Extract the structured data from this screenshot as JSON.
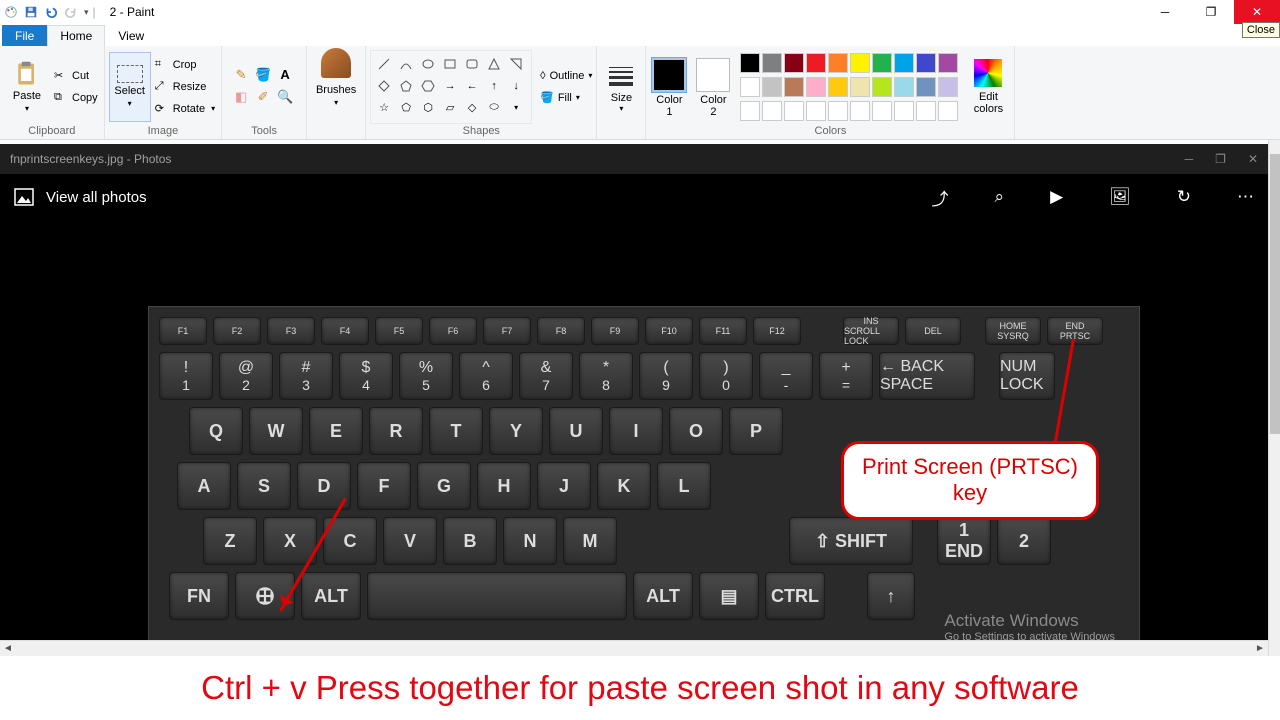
{
  "window": {
    "title": "2 - Paint",
    "close_tooltip": "Close"
  },
  "tabs": {
    "file": "File",
    "home": "Home",
    "view": "View"
  },
  "clipboard": {
    "paste": "Paste",
    "cut": "Cut",
    "copy": "Copy",
    "label": "Clipboard"
  },
  "image": {
    "select": "Select",
    "crop": "Crop",
    "resize": "Resize",
    "rotate": "Rotate",
    "label": "Image"
  },
  "tools": {
    "label": "Tools"
  },
  "brushes": {
    "label": "Brushes"
  },
  "shapes": {
    "outline": "Outline",
    "fill": "Fill",
    "label": "Shapes"
  },
  "size": {
    "label": "Size"
  },
  "colors": {
    "c1": "Color\n1",
    "c2": "Color\n2",
    "edit": "Edit\ncolors",
    "label": "Colors"
  },
  "palette_top": [
    "#000",
    "#7f7f7f",
    "#880015",
    "#ed1c24",
    "#ff7f27",
    "#fff200",
    "#22b14c",
    "#00a2e8",
    "#3f48cc",
    "#a349a4"
  ],
  "palette_mid": [
    "#fff",
    "#c3c3c3",
    "#b97a57",
    "#ffaec9",
    "#ffc90e",
    "#efe4b0",
    "#b5e61d",
    "#99d9ea",
    "#7092be",
    "#c8bfe7"
  ],
  "photos": {
    "title": "fnprintscreenkeys.jpg - Photos",
    "view_all": "View all photos"
  },
  "keyboard": {
    "fn_row": [
      "F1",
      "F2",
      "F3",
      "F4",
      "F5",
      "F6",
      "F7",
      "F8",
      "F9",
      "F10",
      "F11",
      "F12"
    ],
    "ins": "INS",
    "del": "DEL",
    "home": "HOME",
    "end": "END",
    "ins_sub": "SCROLL LOCK",
    "home_sub": "SYSRQ",
    "end_sub": "PRTSC",
    "num_row": [
      [
        "!",
        "1"
      ],
      [
        "@",
        "2"
      ],
      [
        "#",
        "3"
      ],
      [
        "$",
        "4"
      ],
      [
        "%",
        "5"
      ],
      [
        "^",
        "6"
      ],
      [
        "&",
        "7"
      ],
      [
        "*",
        "8"
      ],
      [
        "(",
        "9"
      ],
      [
        ")",
        "0"
      ],
      [
        "_",
        "-"
      ],
      [
        "+",
        "="
      ]
    ],
    "backspace": "BACK\nSPACE",
    "numlock": "NUM\nLOCK",
    "qwerty": [
      "Q",
      "W",
      "E",
      "R",
      "T",
      "Y",
      "U",
      "I",
      "O",
      "P"
    ],
    "asdf": [
      "A",
      "S",
      "D",
      "F",
      "G",
      "H",
      "J",
      "K",
      "L"
    ],
    "zxcv": [
      "Z",
      "X",
      "C",
      "V",
      "B",
      "N",
      "M"
    ],
    "shift": "SHIFT",
    "alt": "ALT",
    "ctrl": "CTRL",
    "numpad_end": "END",
    "numpad_1": "1",
    "numpad_2": "2",
    "callout": "Print Screen (PRTSC)\nkey"
  },
  "watermark": {
    "title": "Activate Windows",
    "sub": "Go to Settings to activate Windows"
  },
  "banner": "Ctrl + v Press together for paste screen shot in any software"
}
